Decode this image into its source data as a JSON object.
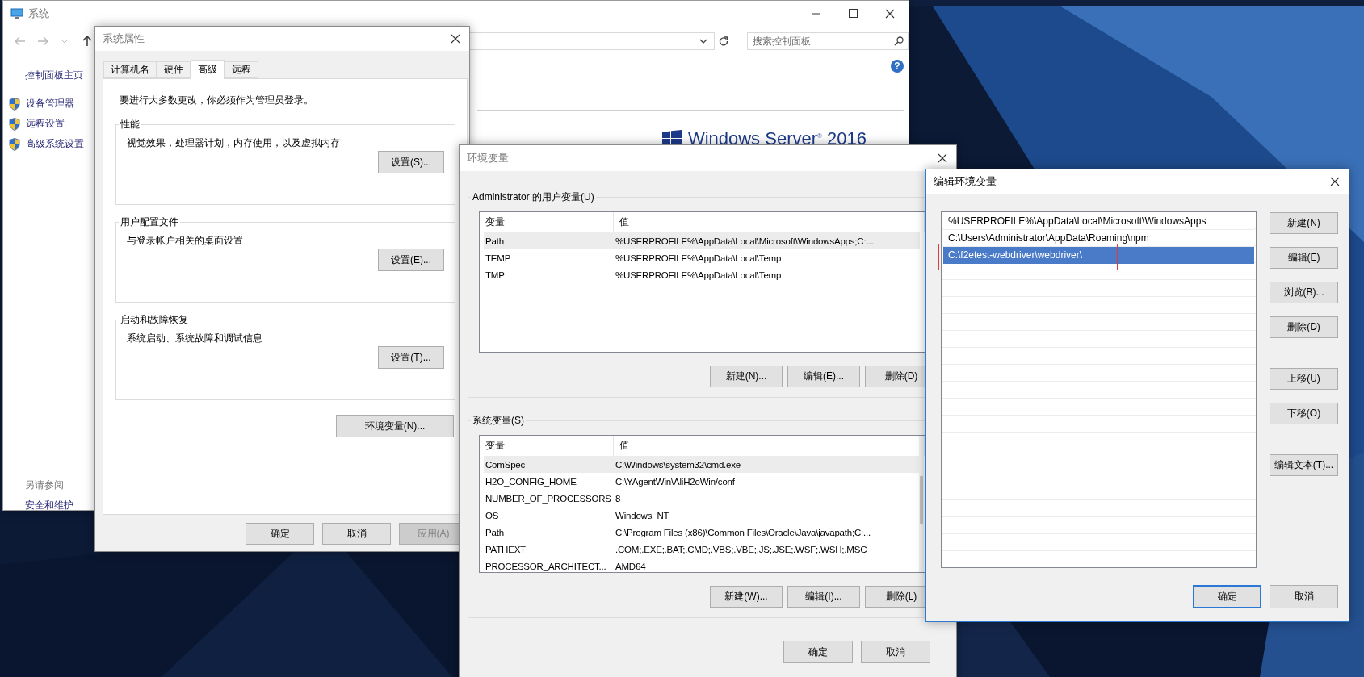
{
  "system_window": {
    "title": "系统",
    "search": {
      "placeholder": "搜索控制面板"
    },
    "sidebar": {
      "home": "控制面板主页",
      "items": [
        "设备管理器",
        "远程设置",
        "高级系统设置"
      ],
      "see_also_title": "另请参阅",
      "see_also": [
        "安全和维护"
      ]
    },
    "help": "?",
    "logo": "Windows Server$^{®}$ 2016"
  },
  "system_properties": {
    "title": "系统属性",
    "tabs": [
      {
        "label": "计算机名",
        "selected": false
      },
      {
        "label": "硬件",
        "selected": false
      },
      {
        "label": "高级",
        "selected": true
      },
      {
        "label": "远程",
        "selected": false
      }
    ],
    "notice": "要进行大多数更改，你必须作为管理员登录。",
    "groups": [
      {
        "title": "性能",
        "description": "视觉效果，处理器计划，内存使用，以及虚拟内存",
        "button": "设置(S)..."
      },
      {
        "title": "用户配置文件",
        "description": "与登录帐户相关的桌面设置",
        "button": "设置(E)..."
      },
      {
        "title": "启动和故障恢复",
        "description": "系统启动、系统故障和调试信息",
        "button": "设置(T)..."
      }
    ],
    "env_button": "环境变量(N)...",
    "buttons": [
      {
        "label": "确定",
        "disabled": false
      },
      {
        "label": "取消",
        "disabled": false
      },
      {
        "label": "应用(A)",
        "disabled": true
      }
    ]
  },
  "environment_variables": {
    "title": "环境变量",
    "sections": [
      {
        "title": "Administrator 的用户变量(U)",
        "columns": [
          "变量",
          "值"
        ],
        "scrollable": false,
        "rows": [
          {
            "name": "Path",
            "value": "%USERPROFILE%\\AppData\\Local\\Microsoft\\WindowsApps;C:...",
            "selected": true
          },
          {
            "name": "TEMP",
            "value": "%USERPROFILE%\\AppData\\Local\\Temp",
            "selected": false
          },
          {
            "name": "TMP",
            "value": "%USERPROFILE%\\AppData\\Local\\Temp",
            "selected": false
          }
        ],
        "buttons": [
          "新建(N)...",
          "编辑(E)...",
          "删除(D)"
        ]
      },
      {
        "title": "系统变量(S)",
        "columns": [
          "变量",
          "值"
        ],
        "scrollable": true,
        "rows": [
          {
            "name": "ComSpec",
            "value": "C:\\Windows\\system32\\cmd.exe",
            "selected": true
          },
          {
            "name": "H2O_CONFIG_HOME",
            "value": "C:\\YAgentWin\\AliH2oWin/conf",
            "selected": false
          },
          {
            "name": "NUMBER_OF_PROCESSORS",
            "value": "8",
            "selected": false
          },
          {
            "name": "OS",
            "value": "Windows_NT",
            "selected": false
          },
          {
            "name": "Path",
            "value": "C:\\Program Files (x86)\\Common Files\\Oracle\\Java\\javapath;C:...",
            "selected": false
          },
          {
            "name": "PATHEXT",
            "value": ".COM;.EXE;.BAT;.CMD;.VBS;.VBE;.JS;.JSE;.WSF;.WSH;.MSC",
            "selected": false
          },
          {
            "name": "PROCESSOR_ARCHITECT...",
            "value": "AMD64",
            "selected": false
          }
        ],
        "buttons": [
          "新建(W)...",
          "编辑(I)...",
          "删除(L)"
        ]
      }
    ],
    "buttons": [
      "确定",
      "取消"
    ]
  },
  "edit_variable": {
    "title": "编辑环境变量",
    "entries": [
      {
        "text": "%USERPROFILE%\\AppData\\Local\\Microsoft\\WindowsApps",
        "selected": false
      },
      {
        "text": "C:\\Users\\Administrator\\AppData\\Roaming\\npm",
        "selected": false
      },
      {
        "text": "C:\\f2etest-webdriver\\webdriver\\",
        "selected": true
      }
    ],
    "button_groups": [
      [
        "新建(N)",
        "编辑(E)",
        "浏览(B)...",
        "删除(D)"
      ],
      [
        "上移(U)",
        "下移(O)"
      ],
      [
        "编辑文本(T)..."
      ]
    ],
    "buttons": [
      {
        "label": "确定",
        "default": true
      },
      {
        "label": "取消",
        "default": false
      }
    ]
  }
}
